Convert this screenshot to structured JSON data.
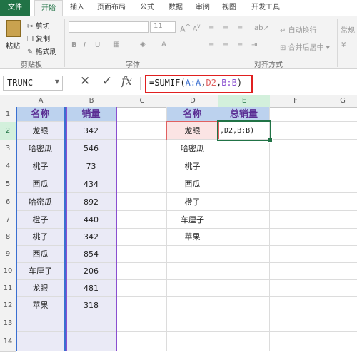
{
  "ribbon_tabs": [
    "文件",
    "开始",
    "插入",
    "页面布局",
    "公式",
    "数据",
    "审阅",
    "视图",
    "开发工具"
  ],
  "clipboard": {
    "paste": "粘贴",
    "cut": "剪切",
    "copy": "复制",
    "format_painter": "格式刷",
    "label": "剪贴板"
  },
  "font_group": {
    "font_size": "11",
    "grow": "A",
    "shrink": "A",
    "bold": "B",
    "italic": "I",
    "underline": "U",
    "label": "字体"
  },
  "align_group": {
    "wrap_text": "自动换行",
    "merge_center": "合并后居中",
    "label": "对齐方式"
  },
  "number_group": {
    "format": "常规"
  },
  "name_box": "TRUNC",
  "formula_icons": {
    "cancel": "✕",
    "enter": "✓",
    "function": "fx"
  },
  "formula": {
    "prefix": "=SUMIF(",
    "arg1": "A:A",
    "sep1": ",",
    "arg2": "D2",
    "sep2": ",",
    "arg3": "B:B",
    "suffix": ")"
  },
  "columns": [
    "A",
    "B",
    "C",
    "D",
    "E",
    "F",
    "G"
  ],
  "rows": [
    "1",
    "2",
    "3",
    "4",
    "5",
    "6",
    "7",
    "8",
    "9",
    "10",
    "11",
    "12",
    "13",
    "14"
  ],
  "table1": {
    "header_name": "名称",
    "header_qty": "销量",
    "rows": [
      {
        "name": "龙眼",
        "qty": "342"
      },
      {
        "name": "哈密瓜",
        "qty": "546"
      },
      {
        "name": "桃子",
        "qty": "73"
      },
      {
        "name": "西瓜",
        "qty": "434"
      },
      {
        "name": "哈密瓜",
        "qty": "892"
      },
      {
        "name": "橙子",
        "qty": "440"
      },
      {
        "name": "桃子",
        "qty": "342"
      },
      {
        "name": "西瓜",
        "qty": "854"
      },
      {
        "name": "车厘子",
        "qty": "206"
      },
      {
        "name": "龙眼",
        "qty": "481"
      },
      {
        "name": "苹果",
        "qty": "318"
      }
    ]
  },
  "table2": {
    "header_name": "名称",
    "header_total": "总销量",
    "names": [
      "龙眼",
      "哈密瓜",
      "桃子",
      "西瓜",
      "橙子",
      "车厘子",
      "苹果"
    ],
    "e2_edit_text": ",D2,B:B)"
  },
  "colors": {
    "excel_green": "#217346",
    "range_a": "#3a6fd0",
    "range_d2": "#e06060",
    "range_b": "#8a4fd0",
    "highlight": "#e02020"
  }
}
